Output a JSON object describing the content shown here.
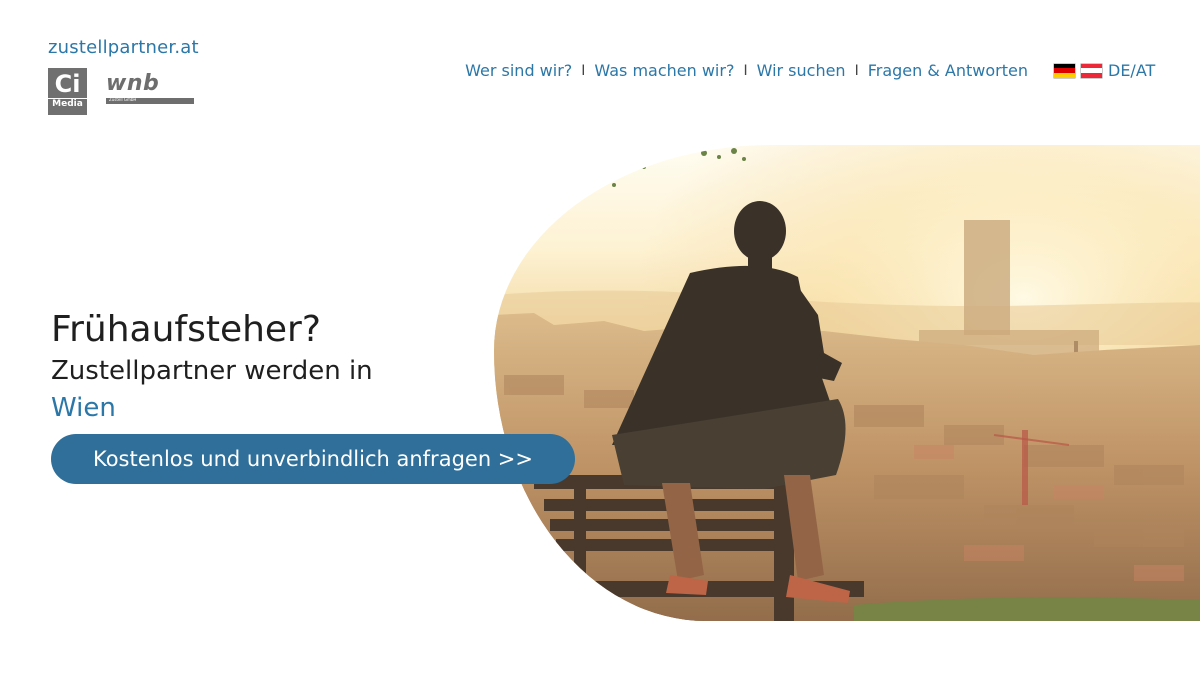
{
  "header": {
    "site_name": "zustellpartner.at",
    "logos": {
      "ci_main": "Ci",
      "ci_sub": "Media",
      "wnb_main": "wnb",
      "wnb_sub": "Zustell GmbH"
    },
    "nav": [
      {
        "label": "Wer sind wir?"
      },
      {
        "label": "Was machen wir?"
      },
      {
        "label": "Wir suchen"
      },
      {
        "label": "Fragen & Antworten"
      }
    ],
    "separator": "I",
    "language": {
      "label": "DE/AT",
      "flags": [
        "german-flag",
        "austrian-flag"
      ]
    }
  },
  "hero": {
    "headline": "Frühaufsteher?",
    "subline": "Zustellpartner werden in",
    "city": "Wien",
    "cta_label": "Kostenlos und unverbindlich anfragen >>",
    "image": "man-on-bench-overlooking-city-at-sunrise"
  },
  "colors": {
    "brand_blue": "#2b77a8",
    "cta_blue": "#2f6f99",
    "logo_gray": "#707070",
    "text_dark": "#1f1f1f",
    "flag_black": "#000000",
    "flag_red": "#dd0000",
    "flag_gold": "#ffcc00",
    "flag_at_red": "#ed2939"
  }
}
